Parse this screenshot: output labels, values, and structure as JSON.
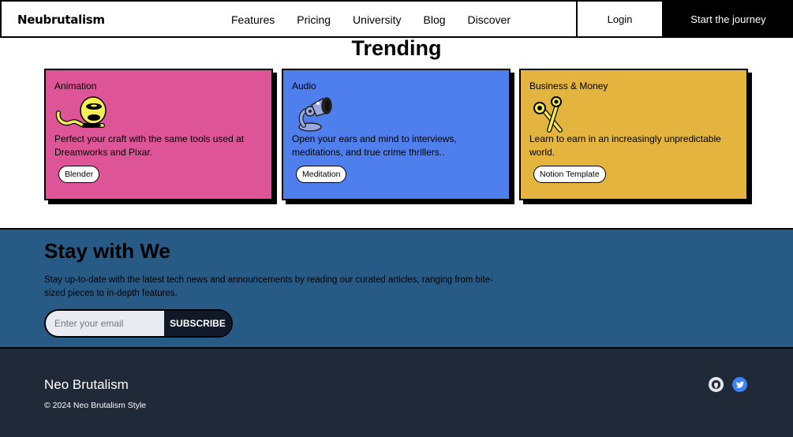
{
  "nav": {
    "brand": "Neubrutalism",
    "links": [
      "Features",
      "Pricing",
      "University",
      "Blog",
      "Discover"
    ],
    "login": "Login",
    "cta": "Start the journey"
  },
  "trending": {
    "title": "Trending",
    "cards": [
      {
        "category": "Animation",
        "description": "Perfect your craft with the same tools used at Dreamworks and Pixar.",
        "tag": "Blender",
        "color": "#dd5597",
        "icon": "animation-creature-icon"
      },
      {
        "category": "Audio",
        "description": "Open your ears and mind to interviews, meditations, and true crime thrillers..",
        "tag": "Meditation",
        "color": "#4e7fec",
        "icon": "audio-lamp-icon"
      },
      {
        "category": "Business & Money",
        "description": "Learn to earn in an increasingly unpredictable world.",
        "tag": "Notion Template",
        "color": "#e3b43e",
        "icon": "scissors-icon"
      }
    ]
  },
  "newsletter": {
    "title": "Stay with We",
    "text": "Stay up-to-date with the latest tech news and announcements by reading our curated articles, ranging from bite-sized pieces to in-depth features.",
    "placeholder": "Enter your email",
    "button": "SUBSCRIBE",
    "color": "#275b86"
  },
  "footer": {
    "title": "Neo Brutalism",
    "copyright": "© 2024 Neo Brutalism Style",
    "social": [
      "github-icon",
      "twitter-icon"
    ]
  }
}
